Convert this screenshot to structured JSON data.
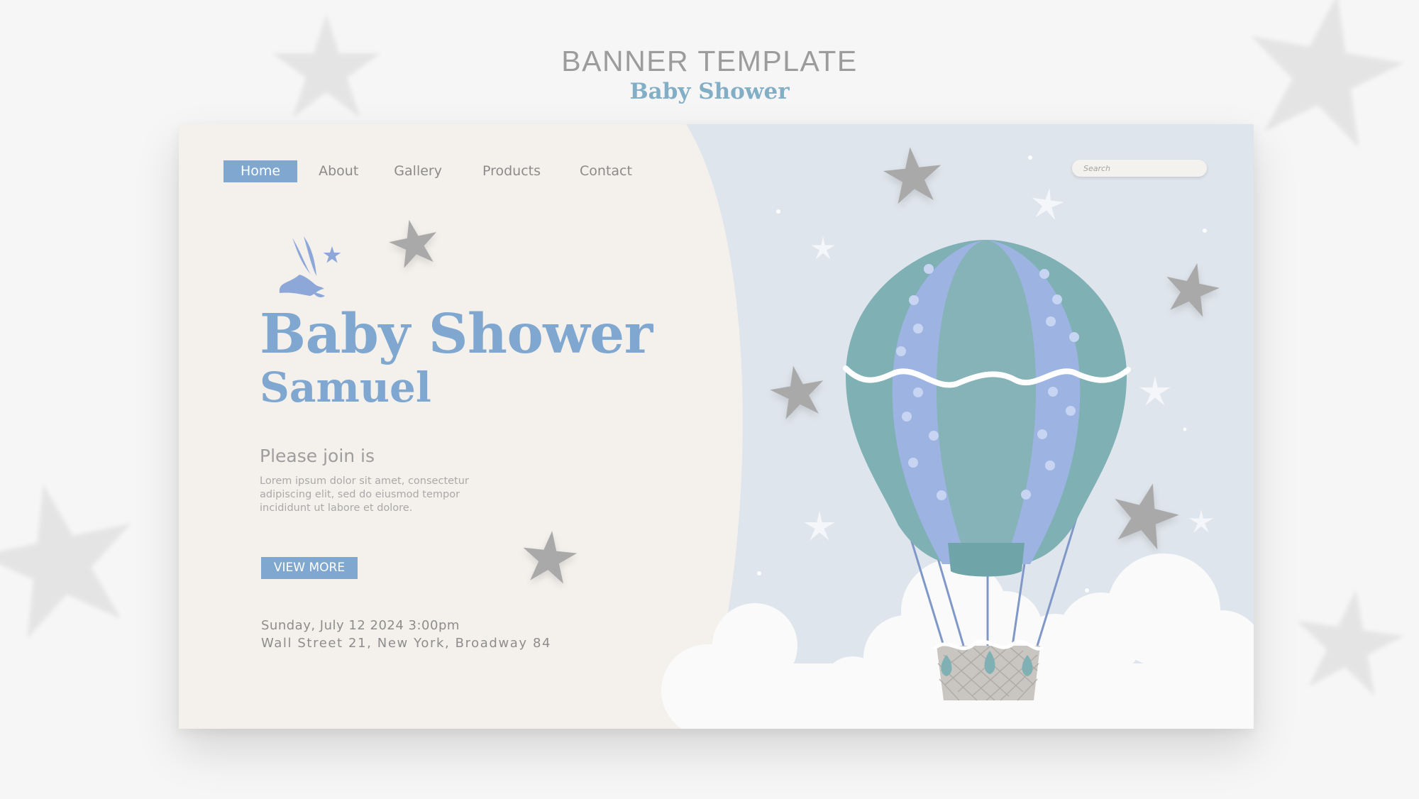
{
  "banner": {
    "title": "BANNER TEMPLATE",
    "subtitle": "Baby Shower"
  },
  "nav": {
    "items": [
      "Home",
      "About",
      "Gallery",
      "Products",
      "Contact"
    ],
    "active_index": 0
  },
  "search": {
    "placeholder": "Search"
  },
  "hero": {
    "title": "Baby Shower",
    "name": "Samuel",
    "join_heading": "Please join is",
    "body": "Lorem ipsum dolor sit amet, consectetur adipiscing elit, sed do eiusmod tempor incididunt ut labore et dolore.",
    "button_label": "VIEW MORE",
    "date": "Sunday, July 12 2024 3:00pm",
    "address": "Wall Street 21, New York, Broadway 84"
  },
  "icons": [
    "star-icon",
    "bird-icon",
    "hot-air-balloon",
    "cloud-icon",
    "sparkle-star-icon"
  ],
  "colors": {
    "accent_blue": "#7fa7cf",
    "left_panel": "#f4f1ed",
    "sky": "#dfe5ec",
    "balloon_teal": "#7fb0b4",
    "balloon_blue": "#9db4e2",
    "star_gray": "#a8a8a8",
    "heading_gray": "#9c9c9c",
    "subtitle_blue": "#82aec6"
  }
}
